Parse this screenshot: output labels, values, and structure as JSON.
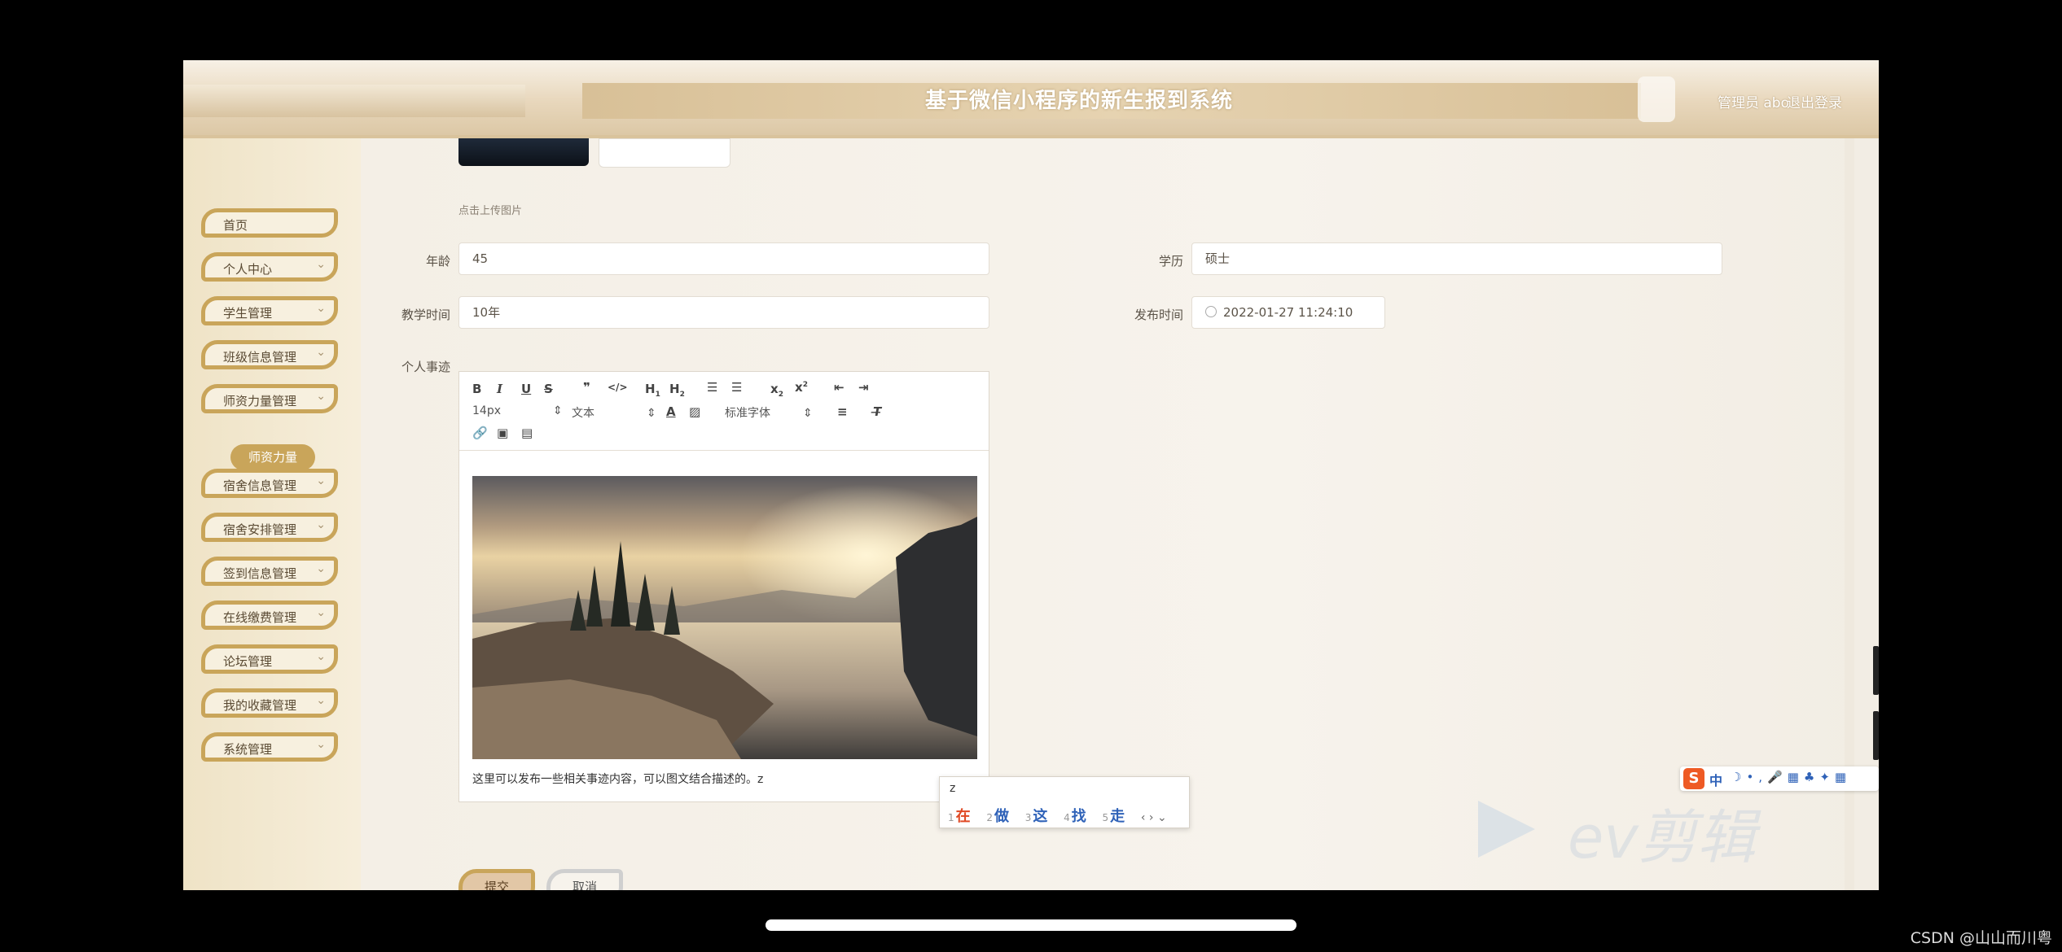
{
  "header": {
    "title": "基于微信小程序的新生报到系统",
    "user": "管理员 abo",
    "logout": "退出登录"
  },
  "sidebar": {
    "items": [
      {
        "label": "首页",
        "chevron": false
      },
      {
        "label": "个人中心",
        "chevron": true
      },
      {
        "label": "学生管理",
        "chevron": true
      },
      {
        "label": "班级信息管理",
        "chevron": true
      },
      {
        "label": "师资力量管理",
        "chevron": true
      },
      {
        "label": "宿舍信息管理",
        "chevron": true
      },
      {
        "label": "宿舍安排管理",
        "chevron": true
      },
      {
        "label": "签到信息管理",
        "chevron": true
      },
      {
        "label": "在线缴费管理",
        "chevron": true
      },
      {
        "label": "论坛管理",
        "chevron": true
      },
      {
        "label": "我的收藏管理",
        "chevron": true
      },
      {
        "label": "系统管理",
        "chevron": true
      }
    ],
    "active_sub": "师资力量"
  },
  "form": {
    "upload_hint": "点击上传图片",
    "age_label": "年龄",
    "age_value": "45",
    "education_label": "学历",
    "education_value": "硕士",
    "teaching_label": "教学时间",
    "teaching_value": "10年",
    "publish_label": "发布时间",
    "publish_value": "2022-01-27 11:24:10",
    "bio_label": "个人事迹"
  },
  "editor": {
    "font_size": "14px",
    "text_type": "文本",
    "font_family": "标准字体",
    "content": "这里可以发布一些相关事迹内容，可以图文结合描述的。z"
  },
  "ime": {
    "input": "z",
    "candidates": [
      "在",
      "做",
      "这",
      "找",
      "走"
    ]
  },
  "buttons": {
    "submit": "提交",
    "cancel": "取消"
  },
  "watermark": "ev剪辑",
  "sogou": {
    "zh": "中"
  },
  "footer_credit": "CSDN @山山而川粤",
  "colors": {
    "accent": "#c9a55a",
    "header": "#e8d7bc",
    "ime_blue": "#2f62b8",
    "ime_first": "#e04a25"
  }
}
